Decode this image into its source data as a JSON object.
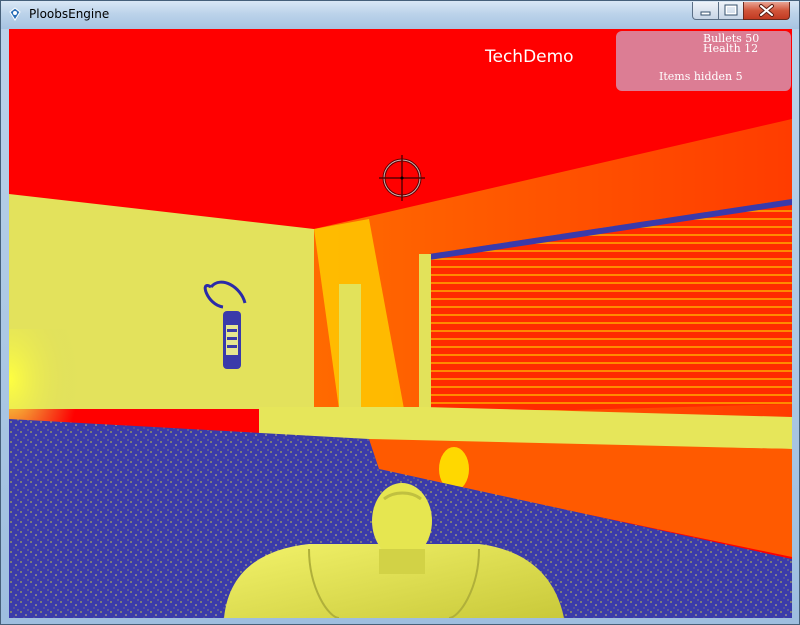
{
  "window": {
    "title": "PloobsEngine",
    "controls": {
      "minimize_icon": "minimize-icon",
      "maximize_icon": "maximize-icon",
      "close_icon": "close-icon"
    }
  },
  "hud": {
    "title": "TechDemo",
    "bullets": "Bullets  50",
    "health": "Health  12",
    "items_hidden": "Items hidden  5",
    "crosshair_icon": "crosshair-icon"
  },
  "scene": {
    "objects": [
      "fire-extinguisher",
      "player-character",
      "glass-wall-with-blinds",
      "wall-light"
    ]
  },
  "colors": {
    "ceiling": "#ff0000",
    "left_wall": "#e3e25c",
    "right_wall": "#ff5a00",
    "floor": "#3a3aaa",
    "character": "#e0e04a",
    "hud_panel": "#d2a0be"
  }
}
